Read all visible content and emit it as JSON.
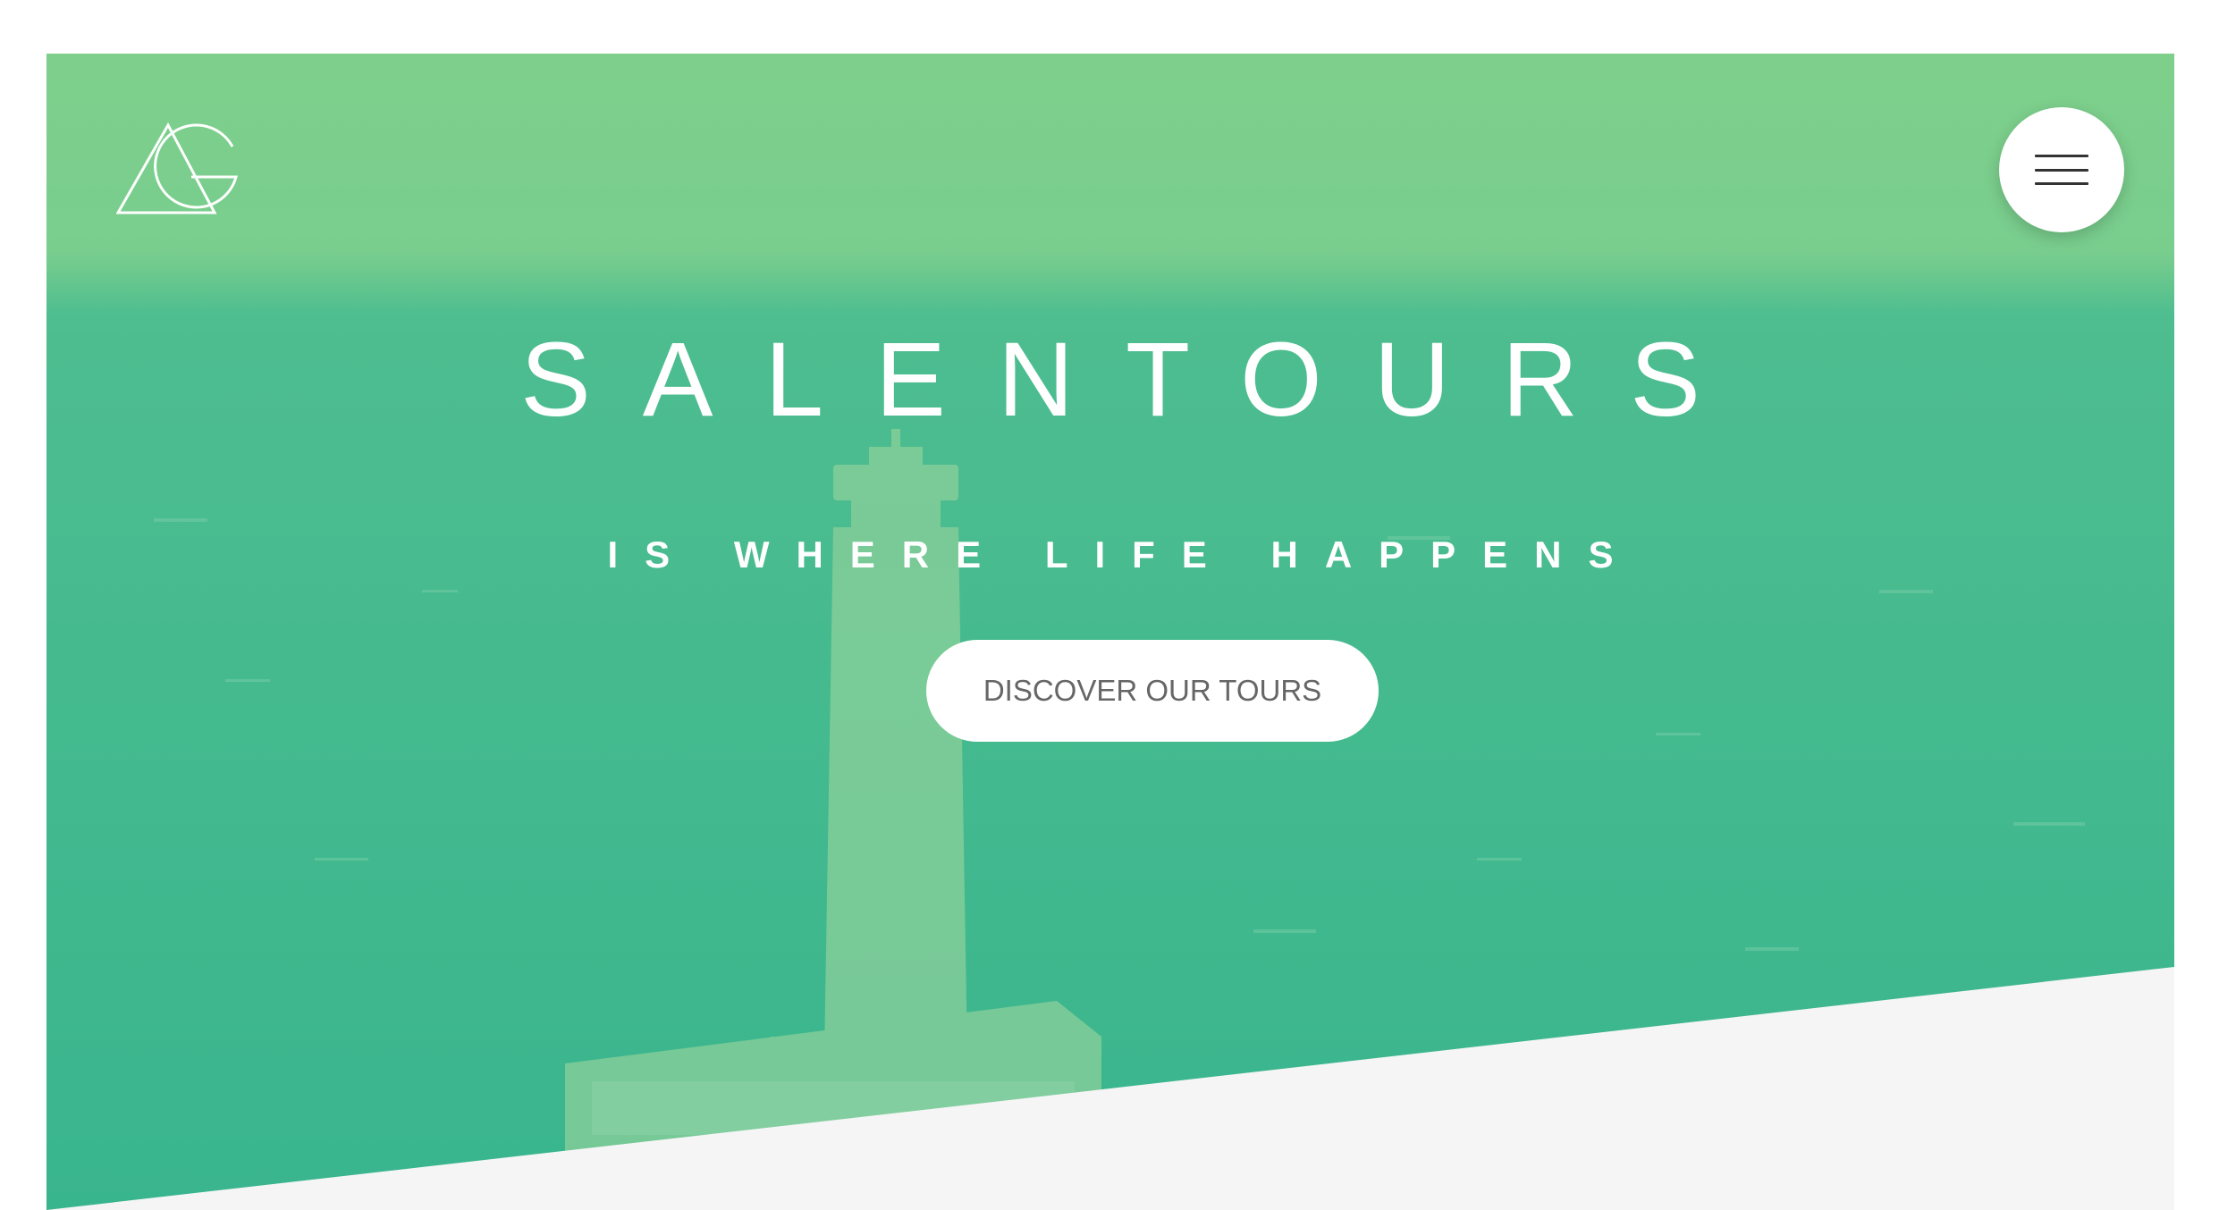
{
  "brand": {
    "logo_icon": "ag-monogram-logo"
  },
  "nav": {
    "menu_icon": "hamburger-menu-icon"
  },
  "hero": {
    "title": "SALENTOURS",
    "subtitle": "IS WHERE LIFE HAPPENS",
    "cta_label": "DISCOVER OUR TOURS",
    "background_image": "lighthouse-by-sea-photo"
  },
  "colors": {
    "overlay_top": "#7ecf8b",
    "overlay_sea": "#3fb88f",
    "section_bg": "#f5f5f5",
    "cta_text": "#666666"
  }
}
